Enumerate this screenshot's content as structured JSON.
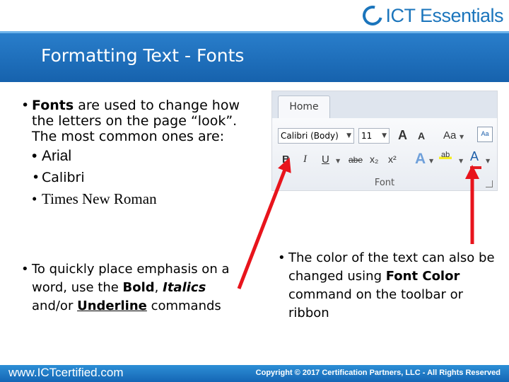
{
  "logo": {
    "text": "ICT Essentials"
  },
  "title": "Formatting Text - Fonts",
  "left_bullets": {
    "b1_prefix": "Fonts",
    "b1_rest": " are used to change how the letters on the page “look”. The most common ones are:",
    "fonts": [
      "Arial",
      "Calibri",
      "Times New Roman"
    ],
    "b2_part1": "To quickly place emphasis on a word, use the ",
    "b2_bold": "Bold",
    "b2_sep1": ", ",
    "b2_italic": "Italics",
    "b2_sep2": " and/or ",
    "b2_underline": "Underline",
    "b2_end": " commands"
  },
  "right_bullet": {
    "part1": "The color of the text can also be changed using ",
    "bold": "Font Color",
    "part2": " command on the toolbar or ribbon"
  },
  "ribbon": {
    "tab": "Home",
    "font_name": "Calibri (Body)",
    "font_size": "11",
    "group_label": "Font",
    "grow_label": "A",
    "shrink_label": "A",
    "case_label": "Aa",
    "clear_label": "Aa",
    "bold_label": "B",
    "italic_label": "I",
    "underline_label": "U",
    "strike_label": "abe",
    "subscript_label": "x₂",
    "superscript_label": "x²",
    "effects_label": "A",
    "highlight_label": "ab",
    "fontcolor_label": "A",
    "accent_colors": {
      "font_color_bar": "#e31e24",
      "highlight": "#f6ee24"
    }
  },
  "footer": {
    "site": "www.ICTcertified.com",
    "copyright": "Copyright © 2017 Certification Partners, LLC - All Rights Reserved"
  },
  "colors": {
    "header": "#1b6fbf",
    "arrow": "#e8141c"
  }
}
